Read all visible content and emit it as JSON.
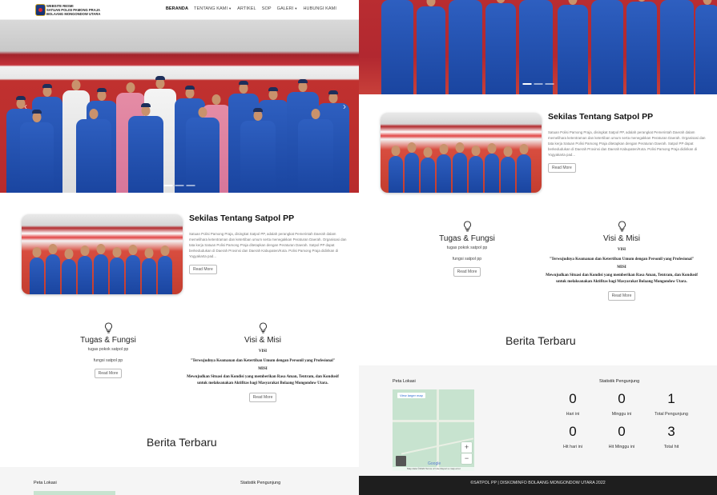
{
  "site": {
    "brand_lines": [
      "WEBSITE RESMI",
      "SATUAN POLISI PAMONG PRAJA",
      "BOLAANG MONGONDOW UTARA"
    ]
  },
  "nav": {
    "items": [
      {
        "label": "BERANDA",
        "caret": false
      },
      {
        "label": "TENTANG KAMI",
        "caret": true
      },
      {
        "label": "ARTIKEL",
        "caret": false
      },
      {
        "label": "SOP",
        "caret": false
      },
      {
        "label": "GALERI",
        "caret": true
      },
      {
        "label": "HUBUNGI KAMI",
        "caret": false
      }
    ]
  },
  "carousel": {
    "prev_icon": "‹",
    "next_icon": "›"
  },
  "about": {
    "title": "Sekilas Tentang Satpol PP",
    "text": "Satuan Polisi Pamong Praja, disingkat Satpol PP, adalah perangkat Pemerintah Daerah dalam memelihara ketentraman dan ketertiban umum serta menegakkan Peraturan Daerah. Organisasi dan tata kerja Satuan Polisi Pamong Praja ditetapkan dengan Peraturan Daerah. Satpol PP dapat berkedudukan di Daerah Provinsi dan Daerah Kabupaten/Kota. Polisi Pamong Praja didirikan di Yogyakarta pad...",
    "button": "Read More"
  },
  "tugas": {
    "title": "Tugas & Fungsi",
    "subtitle": "tugas pokok satpol pp",
    "body": "fungsi satpol pp",
    "button": "Read More"
  },
  "visi": {
    "title": "Visi & Misi",
    "visi_label": "VISI",
    "visi_text": "\"Terwujudnya Keamanan dan Ketertiban Umum dengan Personil yang Profesional\"",
    "misi_label": "MISI",
    "misi_text": "Mewujudkan Situasi dan Kondisi yang memberikan Rasa Aman, Tentram, dan Kondusif untuk melaksanakan  Aktifitas bagi Masyarakat Bolaang Mongondow Utara.",
    "button": "Read More"
  },
  "news": {
    "title": "Berita Terbaru"
  },
  "map": {
    "title": "Peta Lokasi",
    "chip": "View larger map",
    "zoom_in": "+",
    "zoom_out": "−",
    "google": "Google",
    "footer": "Map data ©2022   Terms of Use   Report a map error"
  },
  "stats": {
    "title": "Statistik Pengunjung",
    "items": [
      {
        "value": "0",
        "label": "Hari ini"
      },
      {
        "value": "0",
        "label": "Minggu ini"
      },
      {
        "value": "1",
        "label": "Total Pengunjung"
      },
      {
        "value": "0",
        "label": "Hit hari ini"
      },
      {
        "value": "0",
        "label": "Hit Minggu ini"
      },
      {
        "value": "3",
        "label": "Total hit"
      }
    ]
  },
  "footer": {
    "text": "©SATPOL PP | DISKOMINFO BOLAANG MONGONDOW UTARA 2022"
  },
  "colors": {
    "uniform": "#1f4fb0",
    "carpet": "#b92d31",
    "footer_bg": "#1e1e1e"
  }
}
